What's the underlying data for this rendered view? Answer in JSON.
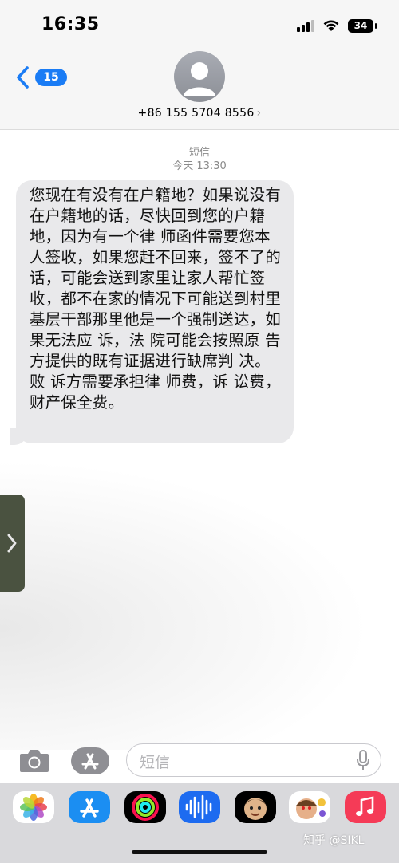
{
  "status_bar": {
    "time": "16:35",
    "battery": "34"
  },
  "nav": {
    "back_count": "15",
    "contact": "+86 155 5704 8556",
    "chevron": "›"
  },
  "conversation": {
    "service": "短信",
    "timestamp": "今天 13:30",
    "message": "您现在有没有在户籍地？如果说没有在户籍地的话，尽快回到您的户籍地，因为有一个律 师函件需要您本人签收，如果您赶不回来，签不了的话，可能会送到家里让家人帮忙签收，都不在家的情况下可能送到村里基层干部那里他是一个强制送达，如果无法应 诉，法 院可能会按照原 告方提供的既有证据进行缺席判 决。败 诉方需要承担律 师费，诉 讼费，财产保全费。"
  },
  "compose": {
    "placeholder": "短信"
  },
  "apps": [
    "photos-icon",
    "app-store-icon",
    "activity-icon",
    "voice-memos-icon",
    "memoji-icon",
    "memoji-stickers-icon",
    "music-icon"
  ],
  "watermark": "知乎 @SIKL"
}
